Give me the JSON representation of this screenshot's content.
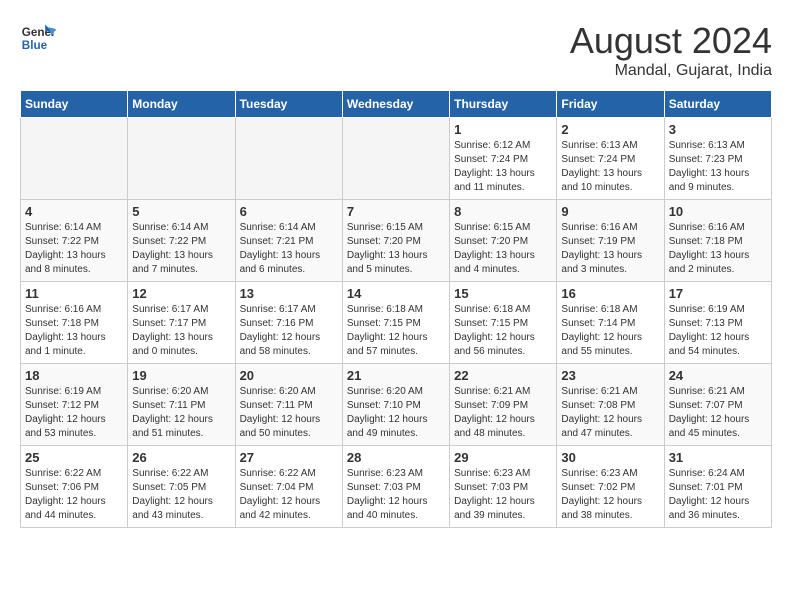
{
  "logo": {
    "line1": "General",
    "line2": "Blue"
  },
  "title": "August 2024",
  "location": "Mandal, Gujarat, India",
  "weekdays": [
    "Sunday",
    "Monday",
    "Tuesday",
    "Wednesday",
    "Thursday",
    "Friday",
    "Saturday"
  ],
  "weeks": [
    [
      {
        "day": "",
        "sunrise": "",
        "sunset": "",
        "daylight": ""
      },
      {
        "day": "",
        "sunrise": "",
        "sunset": "",
        "daylight": ""
      },
      {
        "day": "",
        "sunrise": "",
        "sunset": "",
        "daylight": ""
      },
      {
        "day": "",
        "sunrise": "",
        "sunset": "",
        "daylight": ""
      },
      {
        "day": "1",
        "sunrise": "Sunrise: 6:12 AM",
        "sunset": "Sunset: 7:24 PM",
        "daylight": "Daylight: 13 hours and 11 minutes."
      },
      {
        "day": "2",
        "sunrise": "Sunrise: 6:13 AM",
        "sunset": "Sunset: 7:24 PM",
        "daylight": "Daylight: 13 hours and 10 minutes."
      },
      {
        "day": "3",
        "sunrise": "Sunrise: 6:13 AM",
        "sunset": "Sunset: 7:23 PM",
        "daylight": "Daylight: 13 hours and 9 minutes."
      }
    ],
    [
      {
        "day": "4",
        "sunrise": "Sunrise: 6:14 AM",
        "sunset": "Sunset: 7:22 PM",
        "daylight": "Daylight: 13 hours and 8 minutes."
      },
      {
        "day": "5",
        "sunrise": "Sunrise: 6:14 AM",
        "sunset": "Sunset: 7:22 PM",
        "daylight": "Daylight: 13 hours and 7 minutes."
      },
      {
        "day": "6",
        "sunrise": "Sunrise: 6:14 AM",
        "sunset": "Sunset: 7:21 PM",
        "daylight": "Daylight: 13 hours and 6 minutes."
      },
      {
        "day": "7",
        "sunrise": "Sunrise: 6:15 AM",
        "sunset": "Sunset: 7:20 PM",
        "daylight": "Daylight: 13 hours and 5 minutes."
      },
      {
        "day": "8",
        "sunrise": "Sunrise: 6:15 AM",
        "sunset": "Sunset: 7:20 PM",
        "daylight": "Daylight: 13 hours and 4 minutes."
      },
      {
        "day": "9",
        "sunrise": "Sunrise: 6:16 AM",
        "sunset": "Sunset: 7:19 PM",
        "daylight": "Daylight: 13 hours and 3 minutes."
      },
      {
        "day": "10",
        "sunrise": "Sunrise: 6:16 AM",
        "sunset": "Sunset: 7:18 PM",
        "daylight": "Daylight: 13 hours and 2 minutes."
      }
    ],
    [
      {
        "day": "11",
        "sunrise": "Sunrise: 6:16 AM",
        "sunset": "Sunset: 7:18 PM",
        "daylight": "Daylight: 13 hours and 1 minute."
      },
      {
        "day": "12",
        "sunrise": "Sunrise: 6:17 AM",
        "sunset": "Sunset: 7:17 PM",
        "daylight": "Daylight: 13 hours and 0 minutes."
      },
      {
        "day": "13",
        "sunrise": "Sunrise: 6:17 AM",
        "sunset": "Sunset: 7:16 PM",
        "daylight": "Daylight: 12 hours and 58 minutes."
      },
      {
        "day": "14",
        "sunrise": "Sunrise: 6:18 AM",
        "sunset": "Sunset: 7:15 PM",
        "daylight": "Daylight: 12 hours and 57 minutes."
      },
      {
        "day": "15",
        "sunrise": "Sunrise: 6:18 AM",
        "sunset": "Sunset: 7:15 PM",
        "daylight": "Daylight: 12 hours and 56 minutes."
      },
      {
        "day": "16",
        "sunrise": "Sunrise: 6:18 AM",
        "sunset": "Sunset: 7:14 PM",
        "daylight": "Daylight: 12 hours and 55 minutes."
      },
      {
        "day": "17",
        "sunrise": "Sunrise: 6:19 AM",
        "sunset": "Sunset: 7:13 PM",
        "daylight": "Daylight: 12 hours and 54 minutes."
      }
    ],
    [
      {
        "day": "18",
        "sunrise": "Sunrise: 6:19 AM",
        "sunset": "Sunset: 7:12 PM",
        "daylight": "Daylight: 12 hours and 53 minutes."
      },
      {
        "day": "19",
        "sunrise": "Sunrise: 6:20 AM",
        "sunset": "Sunset: 7:11 PM",
        "daylight": "Daylight: 12 hours and 51 minutes."
      },
      {
        "day": "20",
        "sunrise": "Sunrise: 6:20 AM",
        "sunset": "Sunset: 7:11 PM",
        "daylight": "Daylight: 12 hours and 50 minutes."
      },
      {
        "day": "21",
        "sunrise": "Sunrise: 6:20 AM",
        "sunset": "Sunset: 7:10 PM",
        "daylight": "Daylight: 12 hours and 49 minutes."
      },
      {
        "day": "22",
        "sunrise": "Sunrise: 6:21 AM",
        "sunset": "Sunset: 7:09 PM",
        "daylight": "Daylight: 12 hours and 48 minutes."
      },
      {
        "day": "23",
        "sunrise": "Sunrise: 6:21 AM",
        "sunset": "Sunset: 7:08 PM",
        "daylight": "Daylight: 12 hours and 47 minutes."
      },
      {
        "day": "24",
        "sunrise": "Sunrise: 6:21 AM",
        "sunset": "Sunset: 7:07 PM",
        "daylight": "Daylight: 12 hours and 45 minutes."
      }
    ],
    [
      {
        "day": "25",
        "sunrise": "Sunrise: 6:22 AM",
        "sunset": "Sunset: 7:06 PM",
        "daylight": "Daylight: 12 hours and 44 minutes."
      },
      {
        "day": "26",
        "sunrise": "Sunrise: 6:22 AM",
        "sunset": "Sunset: 7:05 PM",
        "daylight": "Daylight: 12 hours and 43 minutes."
      },
      {
        "day": "27",
        "sunrise": "Sunrise: 6:22 AM",
        "sunset": "Sunset: 7:04 PM",
        "daylight": "Daylight: 12 hours and 42 minutes."
      },
      {
        "day": "28",
        "sunrise": "Sunrise: 6:23 AM",
        "sunset": "Sunset: 7:03 PM",
        "daylight": "Daylight: 12 hours and 40 minutes."
      },
      {
        "day": "29",
        "sunrise": "Sunrise: 6:23 AM",
        "sunset": "Sunset: 7:03 PM",
        "daylight": "Daylight: 12 hours and 39 minutes."
      },
      {
        "day": "30",
        "sunrise": "Sunrise: 6:23 AM",
        "sunset": "Sunset: 7:02 PM",
        "daylight": "Daylight: 12 hours and 38 minutes."
      },
      {
        "day": "31",
        "sunrise": "Sunrise: 6:24 AM",
        "sunset": "Sunset: 7:01 PM",
        "daylight": "Daylight: 12 hours and 36 minutes."
      }
    ]
  ]
}
